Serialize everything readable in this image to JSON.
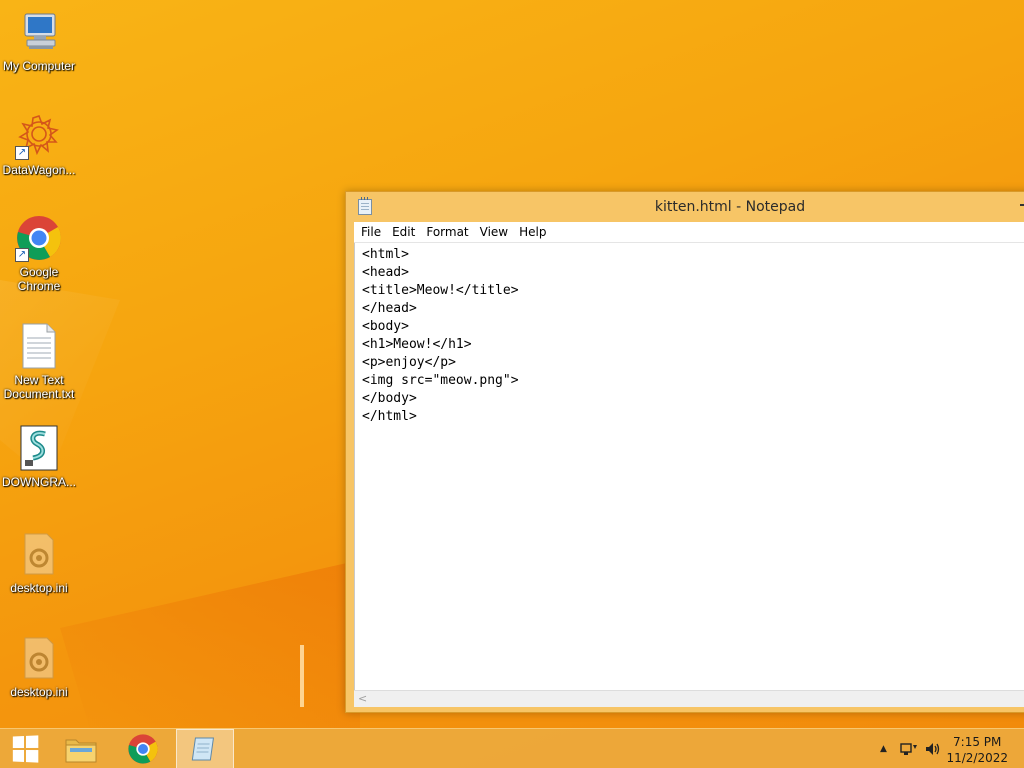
{
  "desktop": {
    "icons": [
      {
        "label": "My Computer",
        "icon": "computer-icon"
      },
      {
        "label": "DataWagon...",
        "icon": "datawagon-icon"
      },
      {
        "label": "Google\nChrome",
        "icon": "chrome-icon"
      },
      {
        "label": "New Text\nDocument.txt",
        "icon": "text-file-icon"
      },
      {
        "label": "DOWNGRA...",
        "icon": "script-file-icon"
      },
      {
        "label": "desktop.ini",
        "icon": "settings-file-icon"
      },
      {
        "label": "desktop.ini",
        "icon": "settings-file-icon"
      }
    ]
  },
  "notepad": {
    "title": "kitten.html - Notepad",
    "menu": [
      "File",
      "Edit",
      "Format",
      "View",
      "Help"
    ],
    "lines": [
      "<html>",
      "<head>",
      "<title>Meow!</title>",
      "</head>",
      "<body>",
      "<h1>Meow!</h1>",
      "<p>enjoy</p>",
      "<img src=\"meow.png\">",
      "</body>",
      "</html>"
    ]
  },
  "taskbar": {
    "buttons": [
      "start-icon",
      "file-explorer-icon",
      "chrome-icon",
      "notepad-icon"
    ],
    "active": "notepad-icon",
    "clock": {
      "time": "7:15 PM",
      "date": "11/2/2022"
    }
  },
  "colors": {
    "wallpaper": "#f6a50f",
    "window_frame": "#f7c566",
    "taskbar": "#ecab40"
  }
}
